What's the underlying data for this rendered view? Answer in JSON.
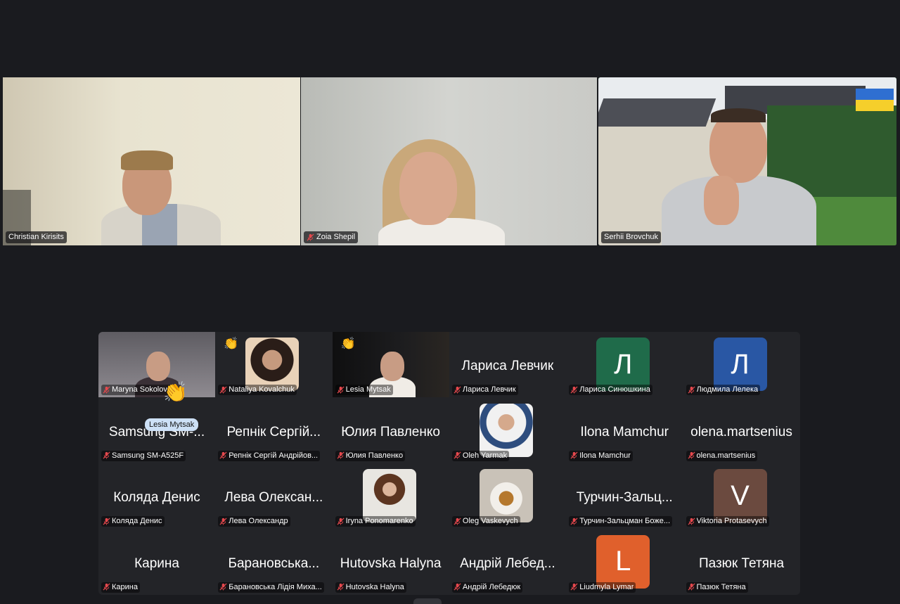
{
  "speakers": [
    {
      "name": "Christian Kirisits",
      "muted": false,
      "active": false
    },
    {
      "name": "Zoia Shepil",
      "muted": true,
      "active": false
    },
    {
      "name": "Serhii Brovchuk",
      "muted": false,
      "active": true
    }
  ],
  "gallery": [
    {
      "display": "",
      "label": "Maryna Sokolova",
      "kind": "video",
      "hand": false
    },
    {
      "display": "",
      "label": "Nataliya Kovalchuk",
      "kind": "photo",
      "hand": true
    },
    {
      "display": "",
      "label": "Lesia Mytsak",
      "kind": "video",
      "hand": true
    },
    {
      "display": "Лариса Левчик",
      "label": "Лариса Левчик",
      "kind": "name",
      "hand": false
    },
    {
      "display": "Л",
      "label": "Лариса Синюшкина",
      "kind": "initial",
      "color": "#1f6b4a",
      "hand": false
    },
    {
      "display": "Л",
      "label": "Людмила Лелека",
      "kind": "initial",
      "color": "#2957a4",
      "hand": false
    },
    {
      "display": "Samsung SM-...",
      "label": "Samsung SM-A525F",
      "kind": "name",
      "hand": false
    },
    {
      "display": "Репнік Сергій...",
      "label": "Репнік Сергій Андрійов...",
      "kind": "name",
      "hand": false
    },
    {
      "display": "Юлия Павленко",
      "label": "Юлия Павленко",
      "kind": "name",
      "hand": false
    },
    {
      "display": "",
      "label": "Oleh Yarmak",
      "kind": "photo",
      "hand": false
    },
    {
      "display": "Ilona Mamchur",
      "label": "Ilona Mamchur",
      "kind": "name",
      "hand": false
    },
    {
      "display": "olena.martsenius",
      "label": "olena.martsenius",
      "kind": "name",
      "hand": false
    },
    {
      "display": "Коляда Денис",
      "label": "Коляда Денис",
      "kind": "name",
      "hand": false
    },
    {
      "display": "Лева Олексан...",
      "label": "Лева Олександр",
      "kind": "name",
      "hand": false
    },
    {
      "display": "",
      "label": "Iryna  Ponomarenko",
      "kind": "photo",
      "hand": false
    },
    {
      "display": "",
      "label": "Oleg Vaskevych",
      "kind": "photo",
      "hand": false
    },
    {
      "display": "Турчин-Зальц...",
      "label": "Турчин-Зальцман Боже...",
      "kind": "name",
      "hand": false
    },
    {
      "display": "V",
      "label": "Viktoria Protasevych",
      "kind": "initial",
      "color": "#6b4a3f",
      "hand": false
    },
    {
      "display": "Карина",
      "label": "Карина",
      "kind": "name",
      "hand": false
    },
    {
      "display": "Барановська...",
      "label": "Барановська Лідія Миха...",
      "kind": "name",
      "hand": false
    },
    {
      "display": "Hutovska Halyna",
      "label": "Hutovska Halyna",
      "kind": "name",
      "hand": false
    },
    {
      "display": "Андрій Лебед...",
      "label": "Андрій Лебедюк",
      "kind": "name",
      "hand": false
    },
    {
      "display": "L",
      "label": "Liudmyla Lymar",
      "kind": "initial",
      "color": "#e0602c",
      "hand": false
    },
    {
      "display": "Пазюк Тетяна",
      "label": "Пазюк Тетяна",
      "kind": "name",
      "hand": false
    }
  ],
  "tooltip": "Lesia Mytsak",
  "colors": {
    "active_border": "#2fbf4a",
    "muted_icon": "#e5484d"
  },
  "icons": {
    "mic_off": "mic-off-icon",
    "raised_hand": "raised-hand-icon"
  }
}
